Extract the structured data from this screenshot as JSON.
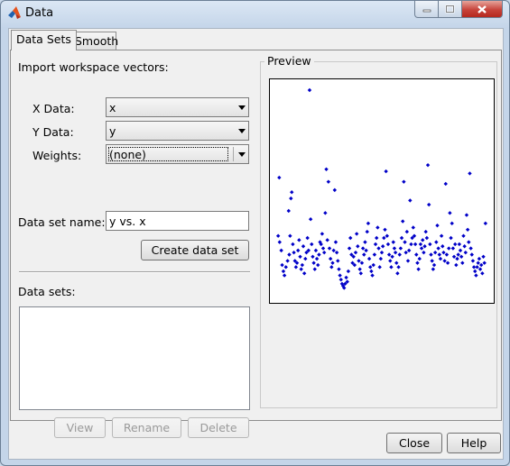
{
  "window": {
    "title": "Data",
    "app_icon": "matlab-logo-icon"
  },
  "tabs": [
    {
      "label": "Data Sets",
      "active": true
    },
    {
      "label": "Smooth",
      "active": false
    }
  ],
  "import": {
    "heading": "Import workspace vectors:",
    "x_label": "X Data:",
    "x_value": "x",
    "y_label": "Y Data:",
    "y_value": "y",
    "w_label": "Weights:",
    "w_value": "(none)"
  },
  "dataset_name": {
    "label": "Data set name:",
    "value": "y vs. x"
  },
  "buttons": {
    "create": "Create data set",
    "view": "View",
    "rename": "Rename",
    "delete": "Delete",
    "close": "Close",
    "help": "Help"
  },
  "datasets": {
    "label": "Data sets:",
    "items": []
  },
  "preview": {
    "title": "Preview",
    "marker_color": "#0000c8",
    "points": [
      [
        0.01,
        0.58
      ],
      [
        0.005,
        0.3
      ],
      [
        0.012,
        0.27
      ],
      [
        0.02,
        0.23
      ],
      [
        0.024,
        0.16
      ],
      [
        0.03,
        0.13
      ],
      [
        0.035,
        0.11
      ],
      [
        0.042,
        0.15
      ],
      [
        0.05,
        0.18
      ],
      [
        0.055,
        0.42
      ],
      [
        0.058,
        0.21
      ],
      [
        0.062,
        0.3
      ],
      [
        0.066,
        0.48
      ],
      [
        0.07,
        0.51
      ],
      [
        0.075,
        0.26
      ],
      [
        0.08,
        0.22
      ],
      [
        0.085,
        0.18
      ],
      [
        0.09,
        0.15
      ],
      [
        0.095,
        0.17
      ],
      [
        0.1,
        0.23
      ],
      [
        0.105,
        0.28
      ],
      [
        0.11,
        0.2
      ],
      [
        0.115,
        0.14
      ],
      [
        0.12,
        0.16
      ],
      [
        0.125,
        0.25
      ],
      [
        0.13,
        0.12
      ],
      [
        0.135,
        0.19
      ],
      [
        0.14,
        0.22
      ],
      [
        0.145,
        0.29
      ],
      [
        0.15,
        0.23
      ],
      [
        0.155,
        1.0
      ],
      [
        0.16,
        0.38
      ],
      [
        0.165,
        0.26
      ],
      [
        0.17,
        0.2
      ],
      [
        0.175,
        0.17
      ],
      [
        0.18,
        0.14
      ],
      [
        0.185,
        0.23
      ],
      [
        0.19,
        0.19
      ],
      [
        0.195,
        0.16
      ],
      [
        0.2,
        0.21
      ],
      [
        0.205,
        0.27
      ],
      [
        0.21,
        0.26
      ],
      [
        0.215,
        0.31
      ],
      [
        0.22,
        0.24
      ],
      [
        0.225,
        0.22
      ],
      [
        0.23,
        0.41
      ],
      [
        0.235,
        0.62
      ],
      [
        0.24,
        0.28
      ],
      [
        0.245,
        0.56
      ],
      [
        0.25,
        0.24
      ],
      [
        0.255,
        0.19
      ],
      [
        0.26,
        0.15
      ],
      [
        0.265,
        0.17
      ],
      [
        0.27,
        0.23
      ],
      [
        0.275,
        0.52
      ],
      [
        0.28,
        0.27
      ],
      [
        0.285,
        0.22
      ],
      [
        0.29,
        0.18
      ],
      [
        0.295,
        0.14
      ],
      [
        0.3,
        0.11
      ],
      [
        0.305,
        0.09
      ],
      [
        0.31,
        0.07
      ],
      [
        0.315,
        0.06
      ],
      [
        0.32,
        0.05
      ],
      [
        0.325,
        0.07
      ],
      [
        0.33,
        0.1
      ],
      [
        0.335,
        0.08
      ],
      [
        0.34,
        0.13
      ],
      [
        0.345,
        0.24
      ],
      [
        0.35,
        0.29
      ],
      [
        0.355,
        0.21
      ],
      [
        0.36,
        0.17
      ],
      [
        0.365,
        0.2
      ],
      [
        0.37,
        0.16
      ],
      [
        0.375,
        0.22
      ],
      [
        0.38,
        0.31
      ],
      [
        0.385,
        0.25
      ],
      [
        0.39,
        0.18
      ],
      [
        0.395,
        0.14
      ],
      [
        0.4,
        0.12
      ],
      [
        0.405,
        0.17
      ],
      [
        0.41,
        0.24
      ],
      [
        0.415,
        0.21
      ],
      [
        0.42,
        0.27
      ],
      [
        0.425,
        0.23
      ],
      [
        0.43,
        0.32
      ],
      [
        0.435,
        0.36
      ],
      [
        0.44,
        0.19
      ],
      [
        0.445,
        0.15
      ],
      [
        0.45,
        0.13
      ],
      [
        0.455,
        0.11
      ],
      [
        0.46,
        0.16
      ],
      [
        0.465,
        0.21
      ],
      [
        0.47,
        0.26
      ],
      [
        0.475,
        0.29
      ],
      [
        0.48,
        0.34
      ],
      [
        0.485,
        0.24
      ],
      [
        0.49,
        0.15
      ],
      [
        0.495,
        0.19
      ],
      [
        0.5,
        0.22
      ],
      [
        0.505,
        0.25
      ],
      [
        0.51,
        0.29
      ],
      [
        0.515,
        0.33
      ],
      [
        0.52,
        0.61
      ],
      [
        0.525,
        0.3
      ],
      [
        0.53,
        0.26
      ],
      [
        0.535,
        0.21
      ],
      [
        0.54,
        0.18
      ],
      [
        0.545,
        0.15
      ],
      [
        0.55,
        0.2
      ],
      [
        0.555,
        0.27
      ],
      [
        0.56,
        0.24
      ],
      [
        0.565,
        0.22
      ],
      [
        0.57,
        0.17
      ],
      [
        0.575,
        0.12
      ],
      [
        0.58,
        0.15
      ],
      [
        0.585,
        0.21
      ],
      [
        0.59,
        0.24
      ],
      [
        0.595,
        0.29
      ],
      [
        0.6,
        0.37
      ],
      [
        0.605,
        0.56
      ],
      [
        0.61,
        0.27
      ],
      [
        0.615,
        0.22
      ],
      [
        0.62,
        0.32
      ],
      [
        0.625,
        0.18
      ],
      [
        0.63,
        0.23
      ],
      [
        0.635,
        0.47
      ],
      [
        0.64,
        0.26
      ],
      [
        0.645,
        0.29
      ],
      [
        0.65,
        0.34
      ],
      [
        0.655,
        0.3
      ],
      [
        0.66,
        0.26
      ],
      [
        0.665,
        0.21
      ],
      [
        0.67,
        0.17
      ],
      [
        0.675,
        0.14
      ],
      [
        0.68,
        0.19
      ],
      [
        0.685,
        0.26
      ],
      [
        0.69,
        0.24
      ],
      [
        0.695,
        0.28
      ],
      [
        0.7,
        0.22
      ],
      [
        0.705,
        0.25
      ],
      [
        0.71,
        0.32
      ],
      [
        0.715,
        0.29
      ],
      [
        0.72,
        0.64
      ],
      [
        0.725,
        0.45
      ],
      [
        0.73,
        0.26
      ],
      [
        0.735,
        0.21
      ],
      [
        0.74,
        0.18
      ],
      [
        0.745,
        0.14
      ],
      [
        0.75,
        0.16
      ],
      [
        0.755,
        0.22
      ],
      [
        0.76,
        0.27
      ],
      [
        0.765,
        0.35
      ],
      [
        0.77,
        0.24
      ],
      [
        0.775,
        0.21
      ],
      [
        0.78,
        0.19
      ],
      [
        0.785,
        0.3
      ],
      [
        0.79,
        0.25
      ],
      [
        0.795,
        0.22
      ],
      [
        0.8,
        0.18
      ],
      [
        0.805,
        0.55
      ],
      [
        0.81,
        0.21
      ],
      [
        0.815,
        0.17
      ],
      [
        0.82,
        0.24
      ],
      [
        0.825,
        0.41
      ],
      [
        0.83,
        0.29
      ],
      [
        0.835,
        0.36
      ],
      [
        0.84,
        0.24
      ],
      [
        0.845,
        0.2
      ],
      [
        0.85,
        0.26
      ],
      [
        0.855,
        0.16
      ],
      [
        0.86,
        0.19
      ],
      [
        0.865,
        0.21
      ],
      [
        0.87,
        0.26
      ],
      [
        0.875,
        0.23
      ],
      [
        0.88,
        0.2
      ],
      [
        0.885,
        0.17
      ],
      [
        0.89,
        0.3
      ],
      [
        0.895,
        0.25
      ],
      [
        0.9,
        0.22
      ],
      [
        0.905,
        0.4
      ],
      [
        0.91,
        0.33
      ],
      [
        0.915,
        0.27
      ],
      [
        0.92,
        0.6
      ],
      [
        0.925,
        0.24
      ],
      [
        0.93,
        0.21
      ],
      [
        0.935,
        0.18
      ],
      [
        0.94,
        0.15
      ],
      [
        0.945,
        0.13
      ],
      [
        0.95,
        0.11
      ],
      [
        0.955,
        0.15
      ],
      [
        0.96,
        0.17
      ],
      [
        0.965,
        0.19
      ],
      [
        0.97,
        0.14
      ],
      [
        0.975,
        0.16
      ],
      [
        0.98,
        0.12
      ],
      [
        0.985,
        0.2
      ],
      [
        0.99,
        0.17
      ],
      [
        0.995,
        0.36
      ]
    ]
  }
}
